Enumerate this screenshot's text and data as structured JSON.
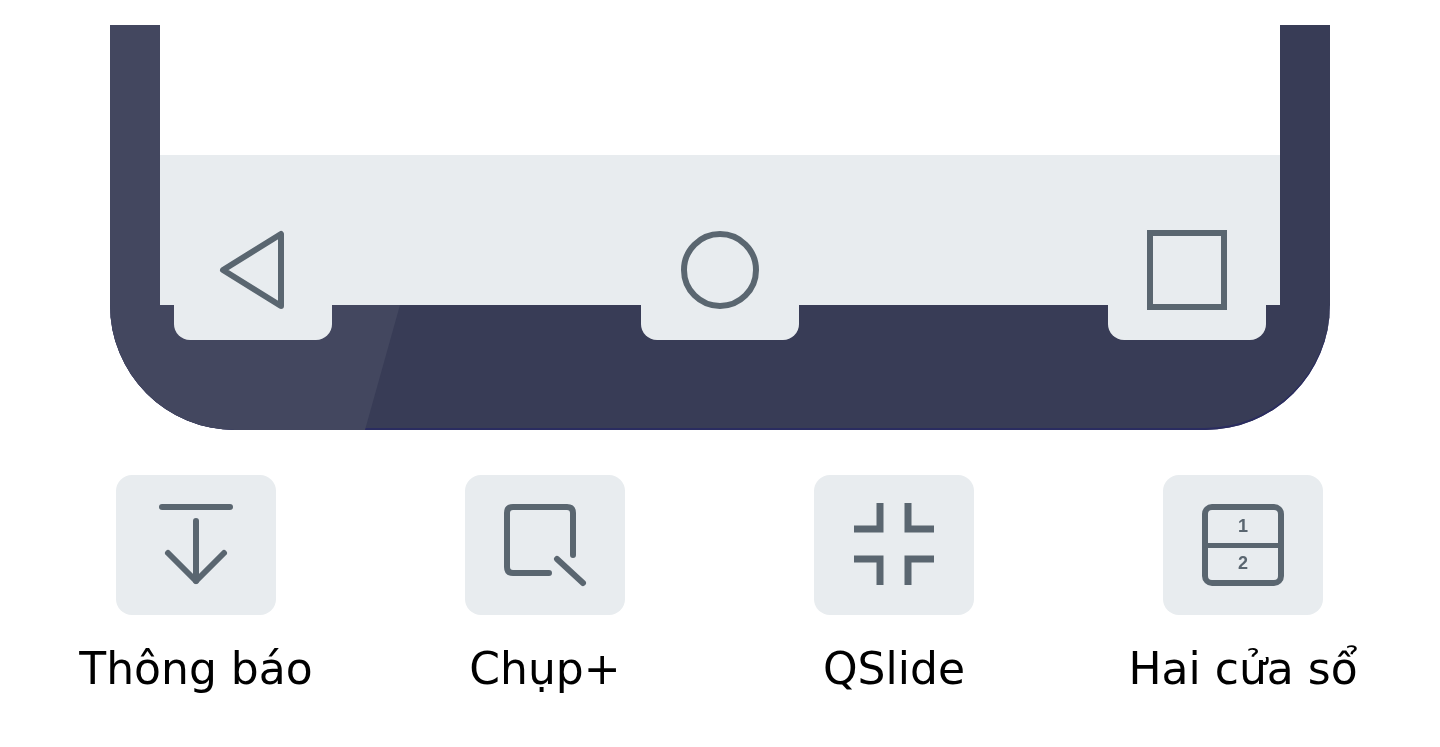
{
  "nav_bar": {
    "buttons": [
      {
        "kind": "back"
      },
      {
        "kind": "home"
      },
      {
        "kind": "recents"
      }
    ]
  },
  "options": [
    {
      "label": "Thông báo",
      "kind": "notification"
    },
    {
      "label": "Chụp+",
      "kind": "capture"
    },
    {
      "label": "QSlide",
      "kind": "qslide"
    },
    {
      "label": "Hai cửa sổ",
      "kind": "dual",
      "numbers": [
        "1",
        "2"
      ]
    }
  ]
}
